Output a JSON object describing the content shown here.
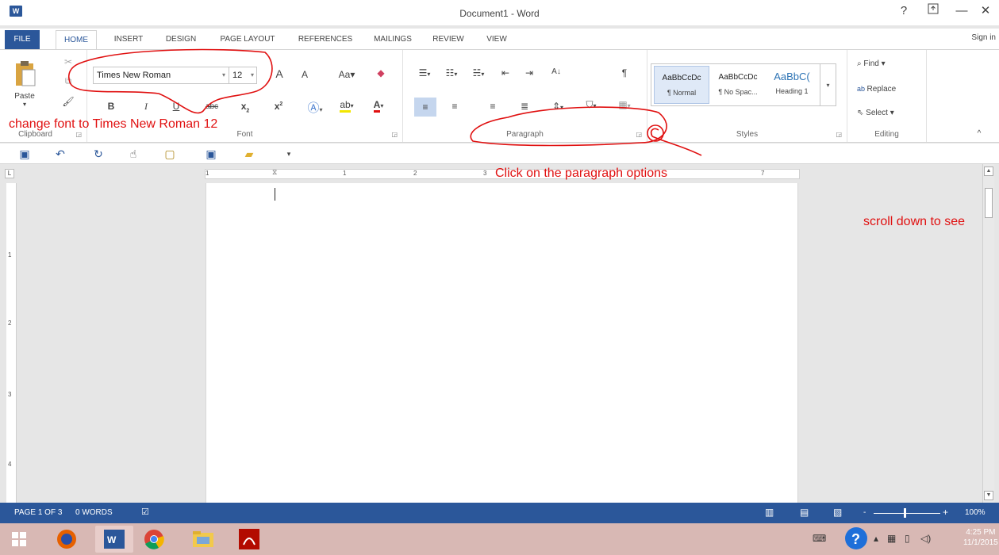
{
  "window": {
    "title": "Document1 - Word",
    "app_icon": "W",
    "controls": {
      "help": "?",
      "ribbon_options": "ribbon-display-options",
      "minimize": "—",
      "restore": "restore-icon",
      "close": "✕"
    }
  },
  "tabs": {
    "file": "FILE",
    "items": [
      "HOME",
      "INSERT",
      "DESIGN",
      "PAGE LAYOUT",
      "REFERENCES",
      "MAILINGS",
      "REVIEW",
      "VIEW"
    ],
    "active": "HOME",
    "sign_in": "Sign in"
  },
  "ribbon": {
    "clipboard": {
      "label": "Clipboard",
      "paste": "Paste"
    },
    "font": {
      "label": "Font",
      "name_value": "Times New Roman",
      "size_value": "12",
      "grow": "A",
      "shrink": "A",
      "change_case": "Aa",
      "bold": "B",
      "italic": "I",
      "underline": "U",
      "strike": "abc",
      "subscript": "x",
      "superscript": "x",
      "font_color_letter": "A"
    },
    "paragraph": {
      "label": "Paragraph"
    },
    "styles": {
      "label": "Styles",
      "items": [
        {
          "preview": "AaBbCcDc",
          "name": "¶ Normal"
        },
        {
          "preview": "AaBbCcDc",
          "name": "¶ No Spac..."
        },
        {
          "preview": "AaBbC(",
          "name": "Heading 1"
        }
      ]
    },
    "editing": {
      "label": "Editing",
      "find": "Find",
      "replace": "Replace",
      "select": "Select"
    }
  },
  "ruler": {
    "marks": [
      "1",
      "1",
      "2",
      "3",
      "7"
    ],
    "vertical_marks": [
      "1",
      "2",
      "3",
      "4"
    ]
  },
  "statusbar": {
    "page": "PAGE 1 OF 3",
    "words": "0 WORDS",
    "zoom": "100%"
  },
  "taskbar": {
    "time": "4:25 PM",
    "date": "11/1/2015"
  },
  "annotations": {
    "font_note": "change font to Times New Roman 12",
    "paragraph_note": "Click on the paragraph options",
    "scroll_note": "scroll down to see"
  },
  "colors": {
    "accent": "#2b579a",
    "annotation": "#e01010",
    "taskbar": "#d8b8b4"
  }
}
